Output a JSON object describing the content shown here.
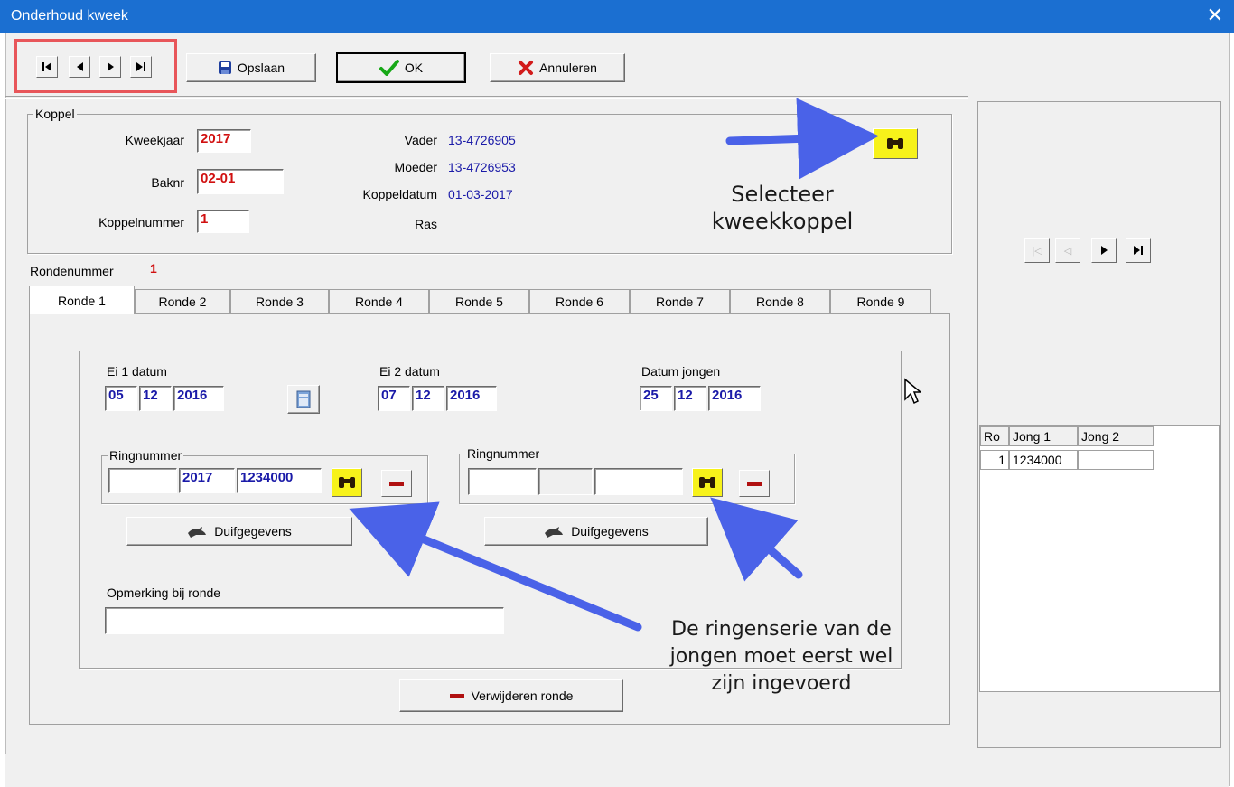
{
  "window": {
    "title": "Onderhoud kweek",
    "close_icon": "close-icon"
  },
  "toolbar": {
    "nav": [
      "first-icon",
      "prev-icon",
      "next-icon",
      "last-icon"
    ],
    "save_label": "Opslaan",
    "ok_label": "OK",
    "cancel_label": "Annuleren"
  },
  "koppel": {
    "legend": "Koppel",
    "kweekjaar_label": "Kweekjaar",
    "kweekjaar_value": "2017",
    "baknr_label": "Baknr",
    "baknr_value": "02-01",
    "koppelnummer_label": "Koppelnummer",
    "koppelnummer_value": "1",
    "vader_label": "Vader",
    "vader_value": "13-4726905",
    "moeder_label": "Moeder",
    "moeder_value": "13-4726953",
    "koppeldatum_label": "Koppeldatum",
    "koppeldatum_value": "01-03-2017",
    "ras_label": "Ras",
    "ras_value": ""
  },
  "annotations": {
    "select_line1": "Selecteer",
    "select_line2": "kweekkoppel",
    "ring_line1": "De ringenserie van de",
    "ring_line2": "jongen moet eerst wel",
    "ring_line3": "zijn ingevoerd"
  },
  "round": {
    "label": "Rondenummer",
    "value": "1",
    "tabs": [
      "Ronde 1",
      "Ronde 2",
      "Ronde 3",
      "Ronde 4",
      "Ronde 5",
      "Ronde 6",
      "Ronde 7",
      "Ronde 8",
      "Ronde 9"
    ],
    "active_tab": "Ronde 1"
  },
  "ronde": {
    "ei1_label": "Ei 1 datum",
    "ei1": {
      "day": "05",
      "month": "12",
      "year": "2016"
    },
    "ei2_label": "Ei 2 datum",
    "ei2": {
      "day": "07",
      "month": "12",
      "year": "2016"
    },
    "jong_label": "Datum jongen",
    "jong": {
      "day": "25",
      "month": "12",
      "year": "2016"
    },
    "ring1": {
      "legend": "Ringnummer",
      "a": "",
      "year": "2017",
      "number": "1234000"
    },
    "ring2": {
      "legend": "Ringnummer",
      "a": "",
      "year": "",
      "number": ""
    },
    "duif_label": "Duifgegevens",
    "opmerking_label": "Opmerking bij ronde",
    "opmerking_value": "",
    "verwijder_label": "Verwijderen ronde"
  },
  "grid": {
    "headers": [
      "Ro",
      "Jong 1",
      "Jong 2"
    ],
    "rows": [
      {
        "ro": "1",
        "jong1": "1234000",
        "jong2": ""
      }
    ]
  },
  "colors": {
    "titlebar": "#1b6fd1",
    "highlight": "#e8565a",
    "annotation_arrow": "#4a62e8",
    "value_blue": "#1a1aa8",
    "value_red": "#d01010"
  }
}
